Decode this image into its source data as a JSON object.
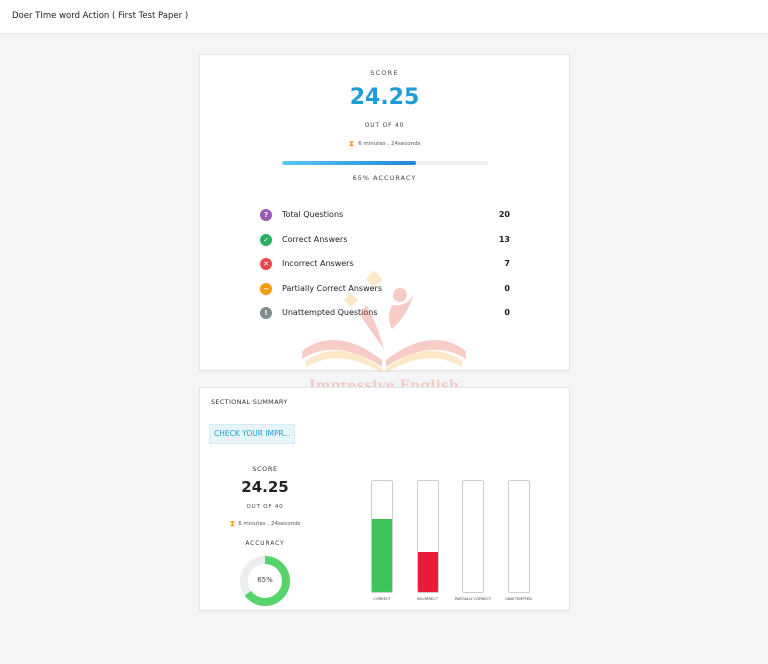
{
  "header": {
    "title": "Doer TIme word Action ( First Test Paper )"
  },
  "score_card": {
    "score_label": "SCORE",
    "score": "24.25",
    "out_of": "OUT OF 40",
    "time": "6 minutes , 24seconds",
    "accuracy_text": "65% ACCURACY",
    "accuracy_fraction": 0.65,
    "stats": [
      {
        "label": "Total Questions",
        "value": "20",
        "icon": "question-icon",
        "glyph": "?",
        "color": "#9b59b6"
      },
      {
        "label": "Correct Answers",
        "value": "13",
        "icon": "check-icon",
        "glyph": "✓",
        "color": "#27ae60"
      },
      {
        "label": "Incorrect Answers",
        "value": "7",
        "icon": "cross-icon",
        "glyph": "✕",
        "color": "#e8474c"
      },
      {
        "label": "Partially Correct Answers",
        "value": "0",
        "icon": "partial-icon",
        "glyph": "~",
        "color": "#f39c12"
      },
      {
        "label": "Unattempted Questions",
        "value": "0",
        "icon": "exclamation-icon",
        "glyph": "!",
        "color": "#7f8c8d"
      }
    ]
  },
  "watermark": {
    "text": "Impressive English"
  },
  "sectional": {
    "title": "SECTIONAL SUMMARY",
    "check_button": "CHECK YOUR IMPR...",
    "score_label": "SCORE",
    "score": "24.25",
    "out_of": "OUT OF 40",
    "time": "6 minutes , 24seconds",
    "accuracy_label": "ACCURACY",
    "accuracy_text": "65%",
    "accuracy_fraction": 0.65,
    "bars": [
      {
        "label": "CORRECT",
        "fraction": 0.65,
        "color": "#3fc45a"
      },
      {
        "label": "INCORRECT",
        "fraction": 0.35,
        "color": "#ea1c3a"
      },
      {
        "label": "PARTIALLY CORRECT",
        "fraction": 0,
        "color": "#f39c12"
      },
      {
        "label": "UNATTEMPTED",
        "fraction": 0,
        "color": "#95a5a6"
      }
    ]
  },
  "colors": {
    "accent": "#1e9cd6",
    "donut": "#57d36b"
  }
}
